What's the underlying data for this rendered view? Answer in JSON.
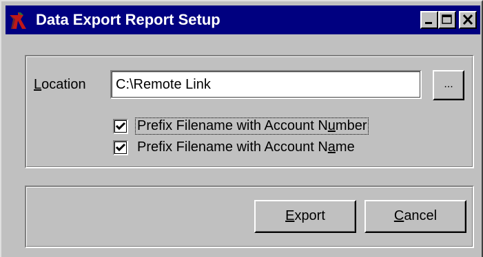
{
  "window": {
    "title": "Data Export Report Setup",
    "title_bar_color": "#000080",
    "body_color": "#c0c0c0",
    "controls": [
      "minimize-icon",
      "maximize-icon",
      "close-icon"
    ]
  },
  "location": {
    "label_mnemonic": "L",
    "label_rest": "ocation",
    "value": "C:\\Remote Link",
    "browse_label": "..."
  },
  "options": {
    "account_number": {
      "checked": true,
      "label_before": "Prefix Filename with Account N",
      "label_mnemonic": "u",
      "label_after": "mber"
    },
    "account_name": {
      "checked": true,
      "label_before": "Prefix Filename with Account N",
      "label_mnemonic": "a",
      "label_after": "me"
    }
  },
  "buttons": {
    "export_mnemonic": "E",
    "export_rest": "xport",
    "cancel_mnemonic": "C",
    "cancel_rest": "ancel"
  }
}
